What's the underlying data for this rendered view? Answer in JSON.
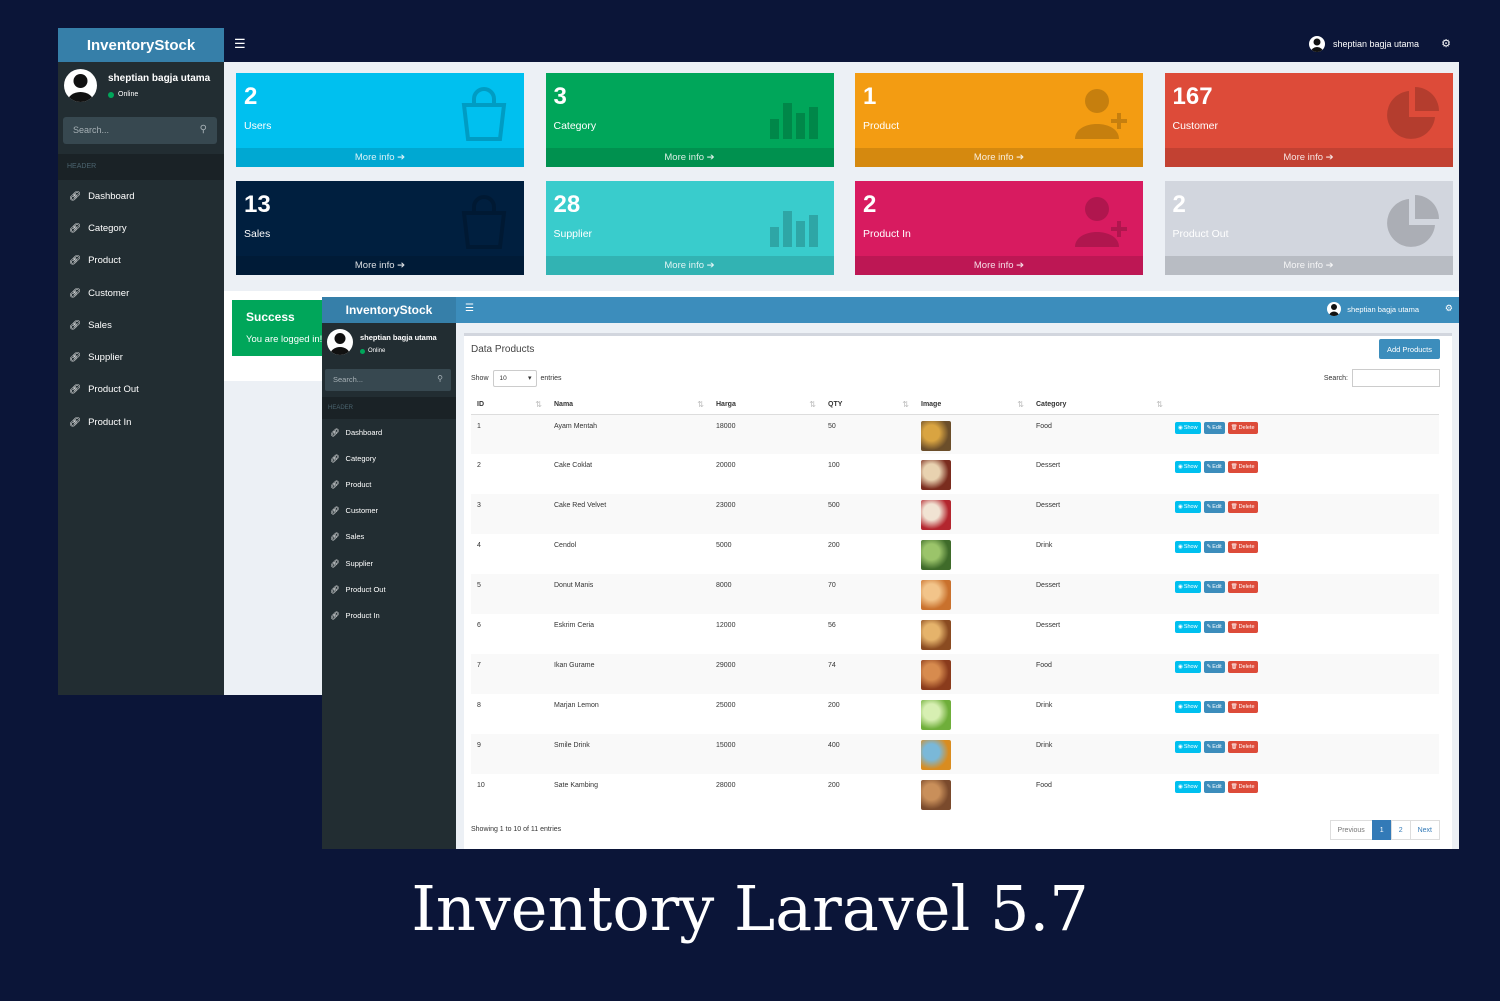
{
  "back_window": {
    "app_title": "InventoryStock",
    "header_user": "sheptian bagja utama",
    "sidebar": {
      "user_name": "sheptian bagja utama",
      "status": "Online",
      "search_placeholder": "Search...",
      "header": "HEADER",
      "items": [
        "Dashboard",
        "Category",
        "Product",
        "Customer",
        "Sales",
        "Supplier",
        "Product Out",
        "Product In"
      ]
    },
    "stats": [
      {
        "value": "2",
        "label": "Users",
        "more": "More info",
        "color": "#00c0ef",
        "icon": "shopping-bag-icon"
      },
      {
        "value": "3",
        "label": "Category",
        "more": "More info",
        "color": "#00a65a",
        "icon": "bar-chart-icon"
      },
      {
        "value": "1",
        "label": "Product",
        "more": "More info",
        "color": "#f39c12",
        "icon": "user-plus-icon"
      },
      {
        "value": "167",
        "label": "Customer",
        "more": "More info",
        "color": "#dd4b39",
        "icon": "pie-chart-icon"
      },
      {
        "value": "13",
        "label": "Sales",
        "more": "More info",
        "color": "#001f3f",
        "icon": "shopping-bag-icon"
      },
      {
        "value": "28",
        "label": "Supplier",
        "more": "More info",
        "color": "#39cccc",
        "icon": "bar-chart-icon"
      },
      {
        "value": "2",
        "label": "Product In",
        "more": "More info",
        "color": "#d81b60",
        "icon": "user-plus-icon"
      },
      {
        "value": "2",
        "label": "Product Out",
        "more": "More info",
        "color": "#d2d6de",
        "icon": "pie-chart-icon"
      }
    ],
    "alert": {
      "title": "Success",
      "message": "You are logged in!"
    }
  },
  "front_window": {
    "app_title": "InventoryStock",
    "header_user": "sheptian bagja utama",
    "sidebar": {
      "user_name": "sheptian bagja utama",
      "status": "Online",
      "search_placeholder": "Search...",
      "header": "HEADER",
      "items": [
        "Dashboard",
        "Category",
        "Product",
        "Customer",
        "Sales",
        "Supplier",
        "Product Out",
        "Product In"
      ]
    },
    "box_title": "Data Products",
    "add_button": "Add Products",
    "show_label": "Show",
    "show_value": "10",
    "entries_label": "entries",
    "search_label": "Search:",
    "columns": [
      "ID",
      "Nama",
      "Harga",
      "QTY",
      "Image",
      "Category",
      ""
    ],
    "rows": [
      {
        "id": "1",
        "nama": "Ayam Mentah",
        "harga": "18000",
        "qty": "50",
        "category": "Food"
      },
      {
        "id": "2",
        "nama": "Cake Coklat",
        "harga": "20000",
        "qty": "100",
        "category": "Dessert"
      },
      {
        "id": "3",
        "nama": "Cake Red Velvet",
        "harga": "23000",
        "qty": "500",
        "category": "Dessert"
      },
      {
        "id": "4",
        "nama": "Cendol",
        "harga": "5000",
        "qty": "200",
        "category": "Drink"
      },
      {
        "id": "5",
        "nama": "Donut Manis",
        "harga": "8000",
        "qty": "70",
        "category": "Dessert"
      },
      {
        "id": "6",
        "nama": "Eskrim Ceria",
        "harga": "12000",
        "qty": "56",
        "category": "Dessert"
      },
      {
        "id": "7",
        "nama": "Ikan Gurame",
        "harga": "29000",
        "qty": "74",
        "category": "Food"
      },
      {
        "id": "8",
        "nama": "Marjan Lemon",
        "harga": "25000",
        "qty": "200",
        "category": "Drink"
      },
      {
        "id": "9",
        "nama": "Smile Drink",
        "harga": "15000",
        "qty": "400",
        "category": "Drink"
      },
      {
        "id": "10",
        "nama": "Sate Kambing",
        "harga": "28000",
        "qty": "200",
        "category": "Food"
      }
    ],
    "actions": {
      "show": "Show",
      "edit": "Edit",
      "delete": "Delete"
    },
    "info": "Showing 1 to 10 of 11 entries",
    "pager": {
      "prev": "Previous",
      "pages": [
        "1",
        "2"
      ],
      "next": "Next"
    }
  },
  "caption": "Inventory Laravel 5.7"
}
